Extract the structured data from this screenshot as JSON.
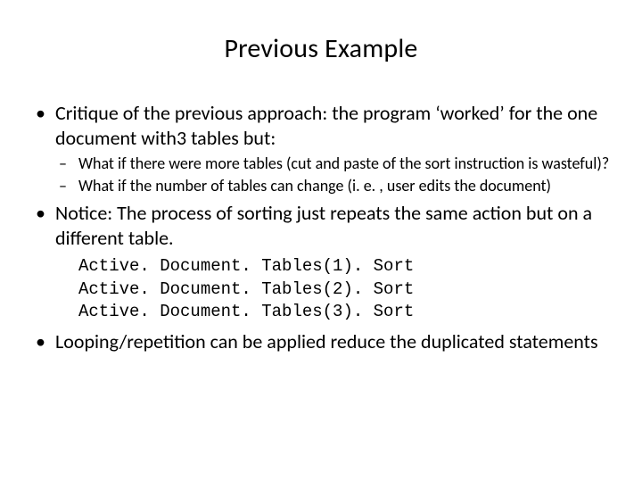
{
  "title": "Previous Example",
  "bullets": {
    "b1": "Critique of the previous approach: the program ‘worked’ for the one document with3 tables but:",
    "b1_sub1": "What if there were more tables (cut and paste of the sort instruction is wasteful)?",
    "b1_sub2": "What if the number of tables can change (i. e. , user edits the document)",
    "b2": "Notice: The process of sorting just repeats the same action but on a different table.",
    "b3": "Looping/repetition can be applied reduce the duplicated statements"
  },
  "code": {
    "line1": "Active. Document. Tables(1). Sort",
    "line2": "Active. Document. Tables(2). Sort",
    "line3": "Active. Document. Tables(3). Sort"
  }
}
